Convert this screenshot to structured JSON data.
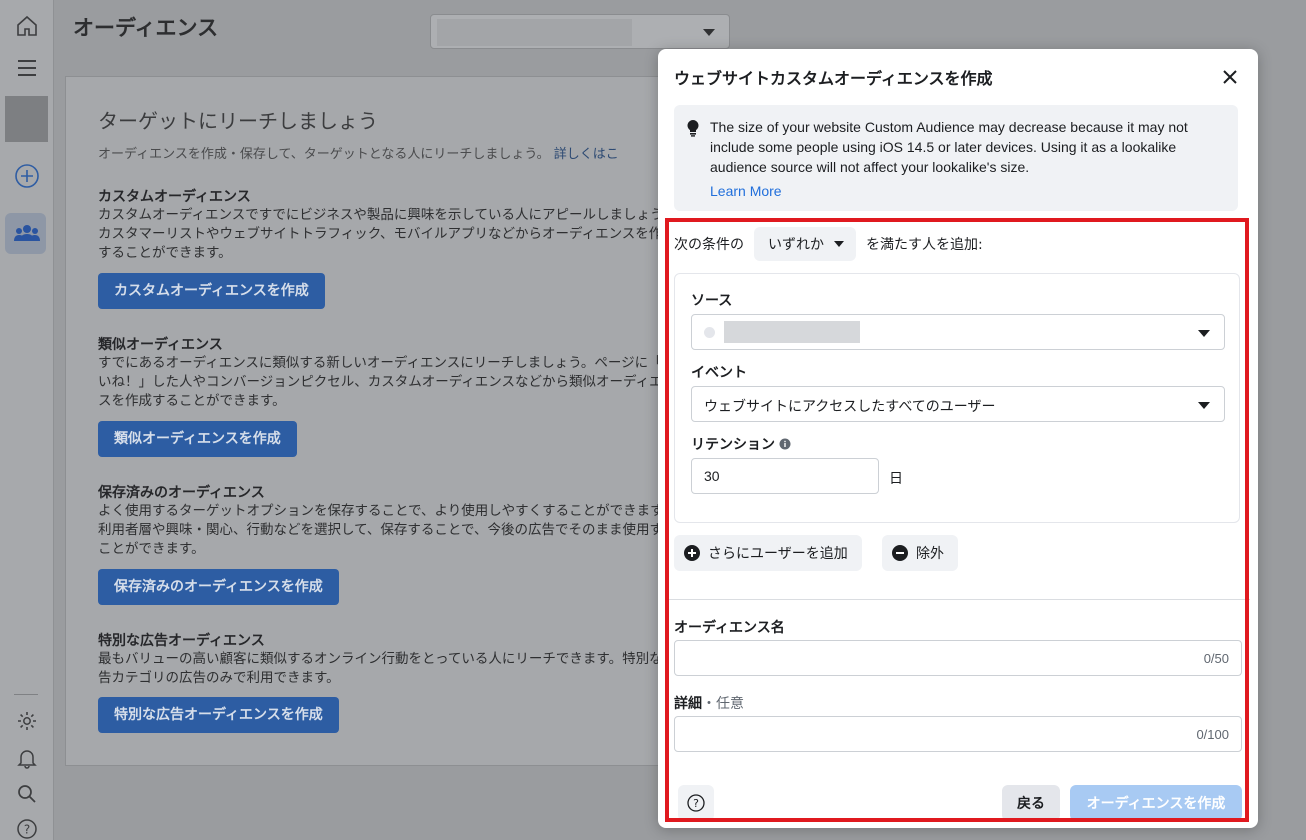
{
  "rail": {
    "icons": [
      "home-icon",
      "menu-icon",
      "account-thumbnail",
      "add-icon",
      "audiences-icon",
      "settings-icon",
      "bell-icon",
      "search-icon",
      "help-icon"
    ]
  },
  "page": {
    "title": "オーディエンス",
    "card": {
      "heading": "ターゲットにリーチしましょう",
      "subtitle": "オーディエンスを作成・保存して、ターゲットとなる人にリーチしましょう。",
      "subtitle_link": "詳しくはこ",
      "sections": [
        {
          "title": "カスタムオーディエンス",
          "description": "カスタムオーディエンスですでにビジネスや製品に興味を示している人にアピールしましょう。カスタマーリストやウェブサイトトラフィック、モバイルアプリなどからオーディエンスを作成することができます。",
          "button": "カスタムオーディエンスを作成"
        },
        {
          "title": "類似オーディエンス",
          "description": "すでにあるオーディエンスに類似する新しいオーディエンスにリーチしましょう。ページに「いいね！」した人やコンバージョンピクセル、カスタムオーディエンスなどから類似オーディエンスを作成することができます。",
          "button": "類似オーディエンスを作成"
        },
        {
          "title": "保存済みのオーディエンス",
          "description": "よく使用するターゲットオプションを保存することで、より使用しやすくすることができます。利用者層や興味・関心、行動などを選択して、保存することで、今後の広告でそのまま使用することができます。",
          "button": "保存済みのオーディエンスを作成"
        },
        {
          "title": "特別な広告オーディエンス",
          "description": "最もバリューの高い顧客に類似するオンライン行動をとっている人にリーチできます。特別な広告カテゴリの広告のみで利用できます。",
          "button": "特別な広告オーディエンスを作成"
        }
      ]
    }
  },
  "modal": {
    "title": "ウェブサイトカスタムオーディエンスを作成",
    "notice": {
      "text": "The size of your website Custom Audience may decrease because it may not include some people using iOS 14.5 or later devices. Using it as a lookalike audience source will not affect your lookalike's size.",
      "link": "Learn More"
    },
    "condition": {
      "prefix": "次の条件の",
      "selected": "いずれか",
      "suffix": "を満たす人を追加:"
    },
    "rule": {
      "source_label": "ソース",
      "event_label": "イベント",
      "event_value": "ウェブサイトにアクセスしたすべてのユーザー",
      "retention_label": "リテンション",
      "retention_value": "30",
      "retention_unit": "日"
    },
    "add_users": "さらにユーザーを追加",
    "exclude": "除外",
    "audience_name": {
      "label": "オーディエンス名",
      "counter": "0/50"
    },
    "details": {
      "label": "詳細",
      "optional": "・任意",
      "counter": "0/100"
    },
    "back": "戻る",
    "create": "オーディエンスを作成"
  },
  "colors": {
    "highlight": "#e0191f",
    "primary_button": "#a8caf3",
    "link": "#216fdb"
  }
}
